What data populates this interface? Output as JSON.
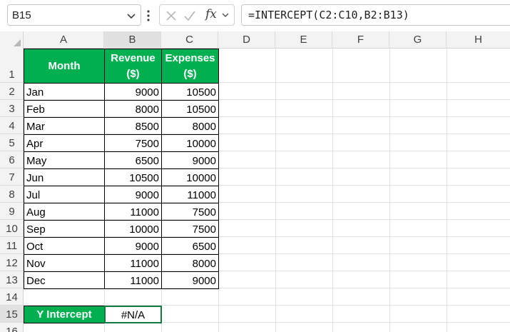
{
  "name_box": {
    "value": "B15"
  },
  "formula_bar": {
    "formula": "=INTERCEPT(C2:C10,B2:B13)",
    "fx_label": "fx"
  },
  "columns": [
    "A",
    "B",
    "C",
    "D",
    "E",
    "F",
    "G",
    "H"
  ],
  "rows": [
    "1",
    "2",
    "3",
    "4",
    "5",
    "6",
    "7",
    "8",
    "9",
    "10",
    "11",
    "12",
    "13",
    "14",
    "15",
    "16"
  ],
  "table": {
    "headers": {
      "month": "Month",
      "revenue_line1": "Revenue",
      "revenue_line2": "($)",
      "expenses_line1": "Expenses",
      "expenses_line2": "($)"
    },
    "data": [
      {
        "month": "Jan",
        "revenue": "9000",
        "expenses": "10500"
      },
      {
        "month": "Feb",
        "revenue": "8000",
        "expenses": "10500"
      },
      {
        "month": "Mar",
        "revenue": "8500",
        "expenses": "8000"
      },
      {
        "month": "Apr",
        "revenue": "7500",
        "expenses": "10000"
      },
      {
        "month": "May",
        "revenue": "6500",
        "expenses": "9000"
      },
      {
        "month": "Jun",
        "revenue": "10500",
        "expenses": "10000"
      },
      {
        "month": "Jul",
        "revenue": "9000",
        "expenses": "11000"
      },
      {
        "month": "Aug",
        "revenue": "11000",
        "expenses": "7500"
      },
      {
        "month": "Sep",
        "revenue": "10000",
        "expenses": "7500"
      },
      {
        "month": "Oct",
        "revenue": "9000",
        "expenses": "6500"
      },
      {
        "month": "Nov",
        "revenue": "11000",
        "expenses": "8000"
      },
      {
        "month": "Dec",
        "revenue": "11000",
        "expenses": "9000"
      }
    ]
  },
  "intercept": {
    "label": "Y Intercept",
    "value": "#N/A"
  },
  "colors": {
    "header_green": "#00b050",
    "grid": "#e1e1e1"
  }
}
